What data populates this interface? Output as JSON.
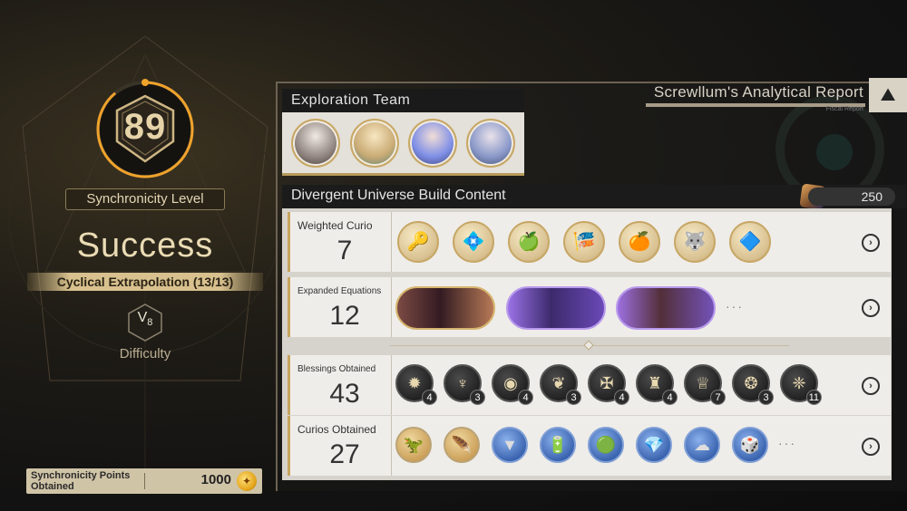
{
  "left": {
    "sync_level": "89",
    "sync_label": "Synchronicity Level",
    "result": "Success",
    "mode": "Cyclical Extrapolation (13/13)",
    "difficulty_base": "V",
    "difficulty_num": "8",
    "difficulty_label": "Difficulty",
    "points_label": "Synchronicity Points Obtained",
    "points_value": "1000",
    "sync_progress": 0.89
  },
  "report": {
    "title": "Screwllum's Analytical Report",
    "subtitle": "Fiscal Report"
  },
  "team": {
    "title": "Exploration Team",
    "members": [
      "character-1",
      "character-2",
      "character-3",
      "character-4"
    ]
  },
  "build": {
    "title": "Divergent Universe Build Content",
    "count": "250",
    "rows": [
      {
        "label": "Weighted Curio",
        "value": "7"
      },
      {
        "label": "Expanded Equations",
        "value": "12"
      },
      {
        "label": "Blessings Obtained",
        "value": "43"
      },
      {
        "label": "Curios Obtained",
        "value": "27"
      }
    ],
    "blessing_counts": [
      "4",
      "3",
      "4",
      "3",
      "4",
      "4",
      "7",
      "3",
      "11"
    ]
  },
  "colors": {
    "accent_gold": "#c7a766",
    "progress_orange": "#f0a32b"
  }
}
